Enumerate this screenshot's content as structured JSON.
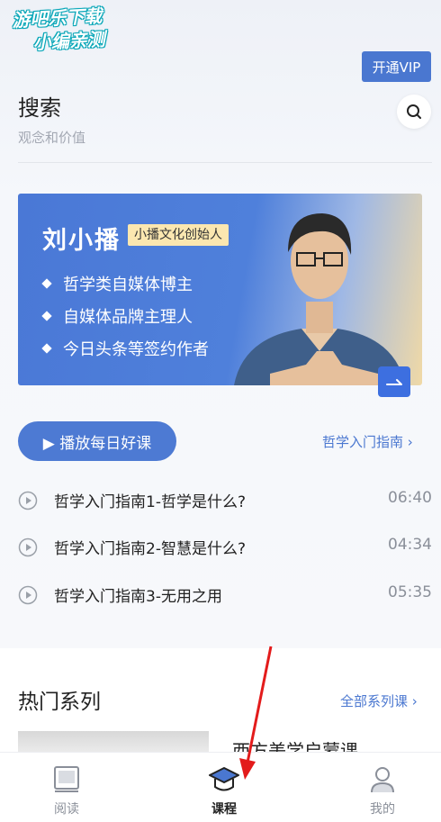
{
  "watermark": {
    "line1": "游吧乐下载",
    "line2": "小编亲测"
  },
  "header": {
    "vip_button": "开通VIP",
    "title": "搜索",
    "subtitle": "观念和价值",
    "search_icon": "search-icon"
  },
  "banner": {
    "name": "刘小播",
    "tag": "小播文化创始人",
    "bullets": [
      "哲学类自媒体博主",
      "自媒体品牌主理人",
      "今日头条等签约作者"
    ],
    "colors": {
      "primary": "#4a78d6",
      "accent": "#fbe7b0"
    }
  },
  "daily": {
    "play_button": "▶ 播放每日好课",
    "guide_link": "哲学入门指南 ›",
    "episodes": [
      {
        "title": "哲学入门指南1-哲学是什么?",
        "duration": "06:40"
      },
      {
        "title": "哲学入门指南2-智慧是什么?",
        "duration": "04:34"
      },
      {
        "title": "哲学入门指南3-无用之用",
        "duration": "05:35"
      }
    ]
  },
  "hot": {
    "title": "热门系列",
    "all_link": "全部系列课 ›",
    "first_series_title": "西方美学启蒙课"
  },
  "tabbar": {
    "tabs": [
      {
        "label": "阅读",
        "icon": "book-icon"
      },
      {
        "label": "课程",
        "icon": "graduation-cap-icon"
      },
      {
        "label": "我的",
        "icon": "user-icon"
      }
    ],
    "active": "课程"
  }
}
